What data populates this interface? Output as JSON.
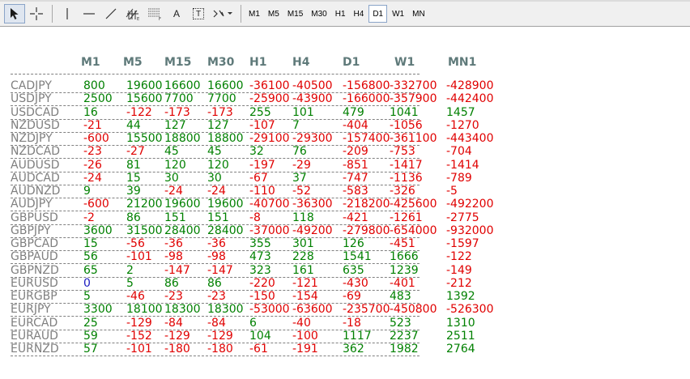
{
  "toolbar": {
    "tools": [
      {
        "name": "cursor-icon",
        "active": true
      },
      {
        "name": "crosshair-icon",
        "active": false
      },
      {
        "name": "vertical-line-icon",
        "active": false
      },
      {
        "name": "horizontal-line-icon",
        "active": false
      },
      {
        "name": "trendline-icon",
        "active": false
      },
      {
        "name": "equidistant-channel-icon",
        "active": false
      },
      {
        "name": "fibonacci-icon",
        "active": false
      },
      {
        "name": "text-icon",
        "label": "A",
        "active": false
      },
      {
        "name": "text-label-icon",
        "label": "T",
        "active": false
      },
      {
        "name": "arrows-icon",
        "active": false
      }
    ],
    "timeframes": [
      "M1",
      "M5",
      "M15",
      "M30",
      "H1",
      "H4",
      "D1",
      "W1",
      "MN"
    ],
    "active_timeframe": "D1"
  },
  "table": {
    "headers": [
      "M1",
      "M5",
      "M15",
      "M30",
      "H1",
      "H4",
      "D1",
      "W1",
      "MN1"
    ],
    "rows": [
      {
        "symbol": "CADJPY",
        "values": [
          "800",
          "19600",
          "16600",
          "16600",
          "-36100",
          "-40500",
          "-156800",
          "-332700",
          "-428900"
        ]
      },
      {
        "symbol": "USDJPY",
        "values": [
          "2500",
          "15600",
          "7700",
          "7700",
          "-25900",
          "-43900",
          "-166000",
          "-357900",
          "-442400"
        ]
      },
      {
        "symbol": "USDCAD",
        "values": [
          "16",
          "-122",
          "-173",
          "-173",
          "255",
          "101",
          "479",
          "1041",
          "1457"
        ]
      },
      {
        "symbol": "NZDUSD",
        "values": [
          "-21",
          "44",
          "127",
          "127",
          "-107",
          "7",
          "-404",
          "-1056",
          "-1270"
        ]
      },
      {
        "symbol": "NZDJPY",
        "values": [
          "-600",
          "15500",
          "18800",
          "18800",
          "-29100",
          "-29300",
          "-157400",
          "-361100",
          "-443400"
        ]
      },
      {
        "symbol": "NZDCAD",
        "values": [
          "-23",
          "-27",
          "45",
          "45",
          "32",
          "76",
          "-209",
          "-753",
          "-704"
        ]
      },
      {
        "symbol": "AUDUSD",
        "values": [
          "-26",
          "81",
          "120",
          "120",
          "-197",
          "-29",
          "-851",
          "-1417",
          "-1414"
        ]
      },
      {
        "symbol": "AUDCAD",
        "values": [
          "-24",
          "15",
          "30",
          "30",
          "-67",
          "37",
          "-747",
          "-1136",
          "-789"
        ]
      },
      {
        "symbol": "AUDNZD",
        "values": [
          "9",
          "39",
          "-24",
          "-24",
          "-110",
          "-52",
          "-583",
          "-326",
          "-5"
        ]
      },
      {
        "symbol": "AUDJPY",
        "values": [
          "-600",
          "21200",
          "19600",
          "19600",
          "-40700",
          "-36300",
          "-218200",
          "-425600",
          "-492200"
        ]
      },
      {
        "symbol": "GBPUSD",
        "values": [
          "-2",
          "86",
          "151",
          "151",
          "-8",
          "118",
          "-421",
          "-1261",
          "-2775"
        ]
      },
      {
        "symbol": "GBPJPY",
        "values": [
          "3600",
          "31500",
          "28400",
          "28400",
          "-37000",
          "-49200",
          "-279800",
          "-654000",
          "-932000"
        ]
      },
      {
        "symbol": "GBPCAD",
        "values": [
          "15",
          "-56",
          "-36",
          "-36",
          "355",
          "301",
          "126",
          "-451",
          "-1597"
        ]
      },
      {
        "symbol": "GBPAUD",
        "values": [
          "56",
          "-101",
          "-98",
          "-98",
          "473",
          "228",
          "1541",
          "1666",
          "-122"
        ]
      },
      {
        "symbol": "GBPNZD",
        "values": [
          "65",
          "2",
          "-147",
          "-147",
          "323",
          "161",
          "635",
          "1239",
          "-149"
        ]
      },
      {
        "symbol": "EURUSD",
        "values": [
          "0",
          "5",
          "86",
          "86",
          "-220",
          "-121",
          "-430",
          "-401",
          "-212"
        ]
      },
      {
        "symbol": "EURGBP",
        "values": [
          "5",
          "-46",
          "-23",
          "-23",
          "-150",
          "-154",
          "-69",
          "483",
          "1392"
        ]
      },
      {
        "symbol": "EURJPY",
        "values": [
          "3300",
          "18100",
          "18300",
          "18300",
          "-53000",
          "-63600",
          "-235700",
          "-450800",
          "-526300"
        ]
      },
      {
        "symbol": "EURCAD",
        "values": [
          "25",
          "-129",
          "-84",
          "-84",
          "6",
          "-40",
          "-18",
          "523",
          "1310"
        ]
      },
      {
        "symbol": "EURAUD",
        "values": [
          "59",
          "-152",
          "-129",
          "-129",
          "104",
          "-100",
          "1117",
          "2237",
          "2511"
        ]
      },
      {
        "symbol": "EURNZD",
        "values": [
          "57",
          "-101",
          "-180",
          "-180",
          "-61",
          "-191",
          "362",
          "1982",
          "2764"
        ]
      }
    ]
  },
  "colors": {
    "positive": "#008000",
    "negative": "#e00000",
    "zero": "#1a1ac0",
    "symbol": "#7f7f7f",
    "header": "#5f7a7a"
  }
}
